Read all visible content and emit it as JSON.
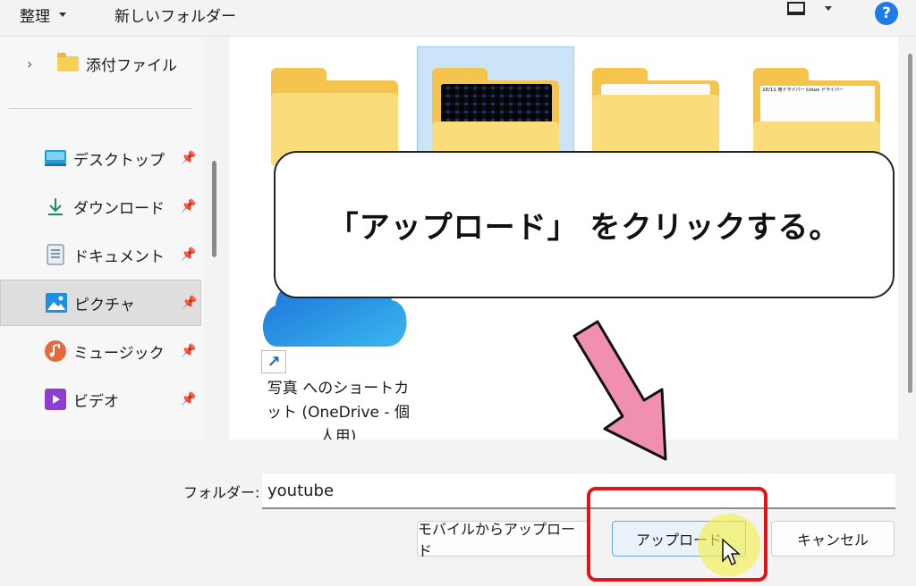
{
  "toolbar": {
    "organize": "整理",
    "new_folder": "新しいフォルダー",
    "help": "?"
  },
  "sidebar": {
    "attachments": "添付ファイル",
    "items": [
      {
        "label": "デスクトップ",
        "icon": "desktop-icon"
      },
      {
        "label": "ダウンロード",
        "icon": "download-icon"
      },
      {
        "label": "ドキュメント",
        "icon": "documents-icon"
      },
      {
        "label": "ピクチャ",
        "icon": "pictures-icon",
        "selected": true
      },
      {
        "label": "ミュージック",
        "icon": "music-icon"
      },
      {
        "label": "ビデオ",
        "icon": "video-icon"
      }
    ]
  },
  "main": {
    "folder_preview": {
      "heading1": "10/11 用ドライバー",
      "heading2": "Linux ドライバー"
    },
    "shortcut_label": "写真 へのショートカット (OneDrive - 個人用)"
  },
  "callout": {
    "text": "「アップロード」 をクリックする。"
  },
  "bottom": {
    "folder_label": "フォルダー:",
    "folder_value": "youtube",
    "mobile_upload": "モバイルからアップロード",
    "upload": "アップロード",
    "cancel": "キャンセル"
  },
  "colors": {
    "highlight": "#e1141c",
    "pink_arrow": "#f08fb0",
    "accent": "#1e7ce6"
  }
}
